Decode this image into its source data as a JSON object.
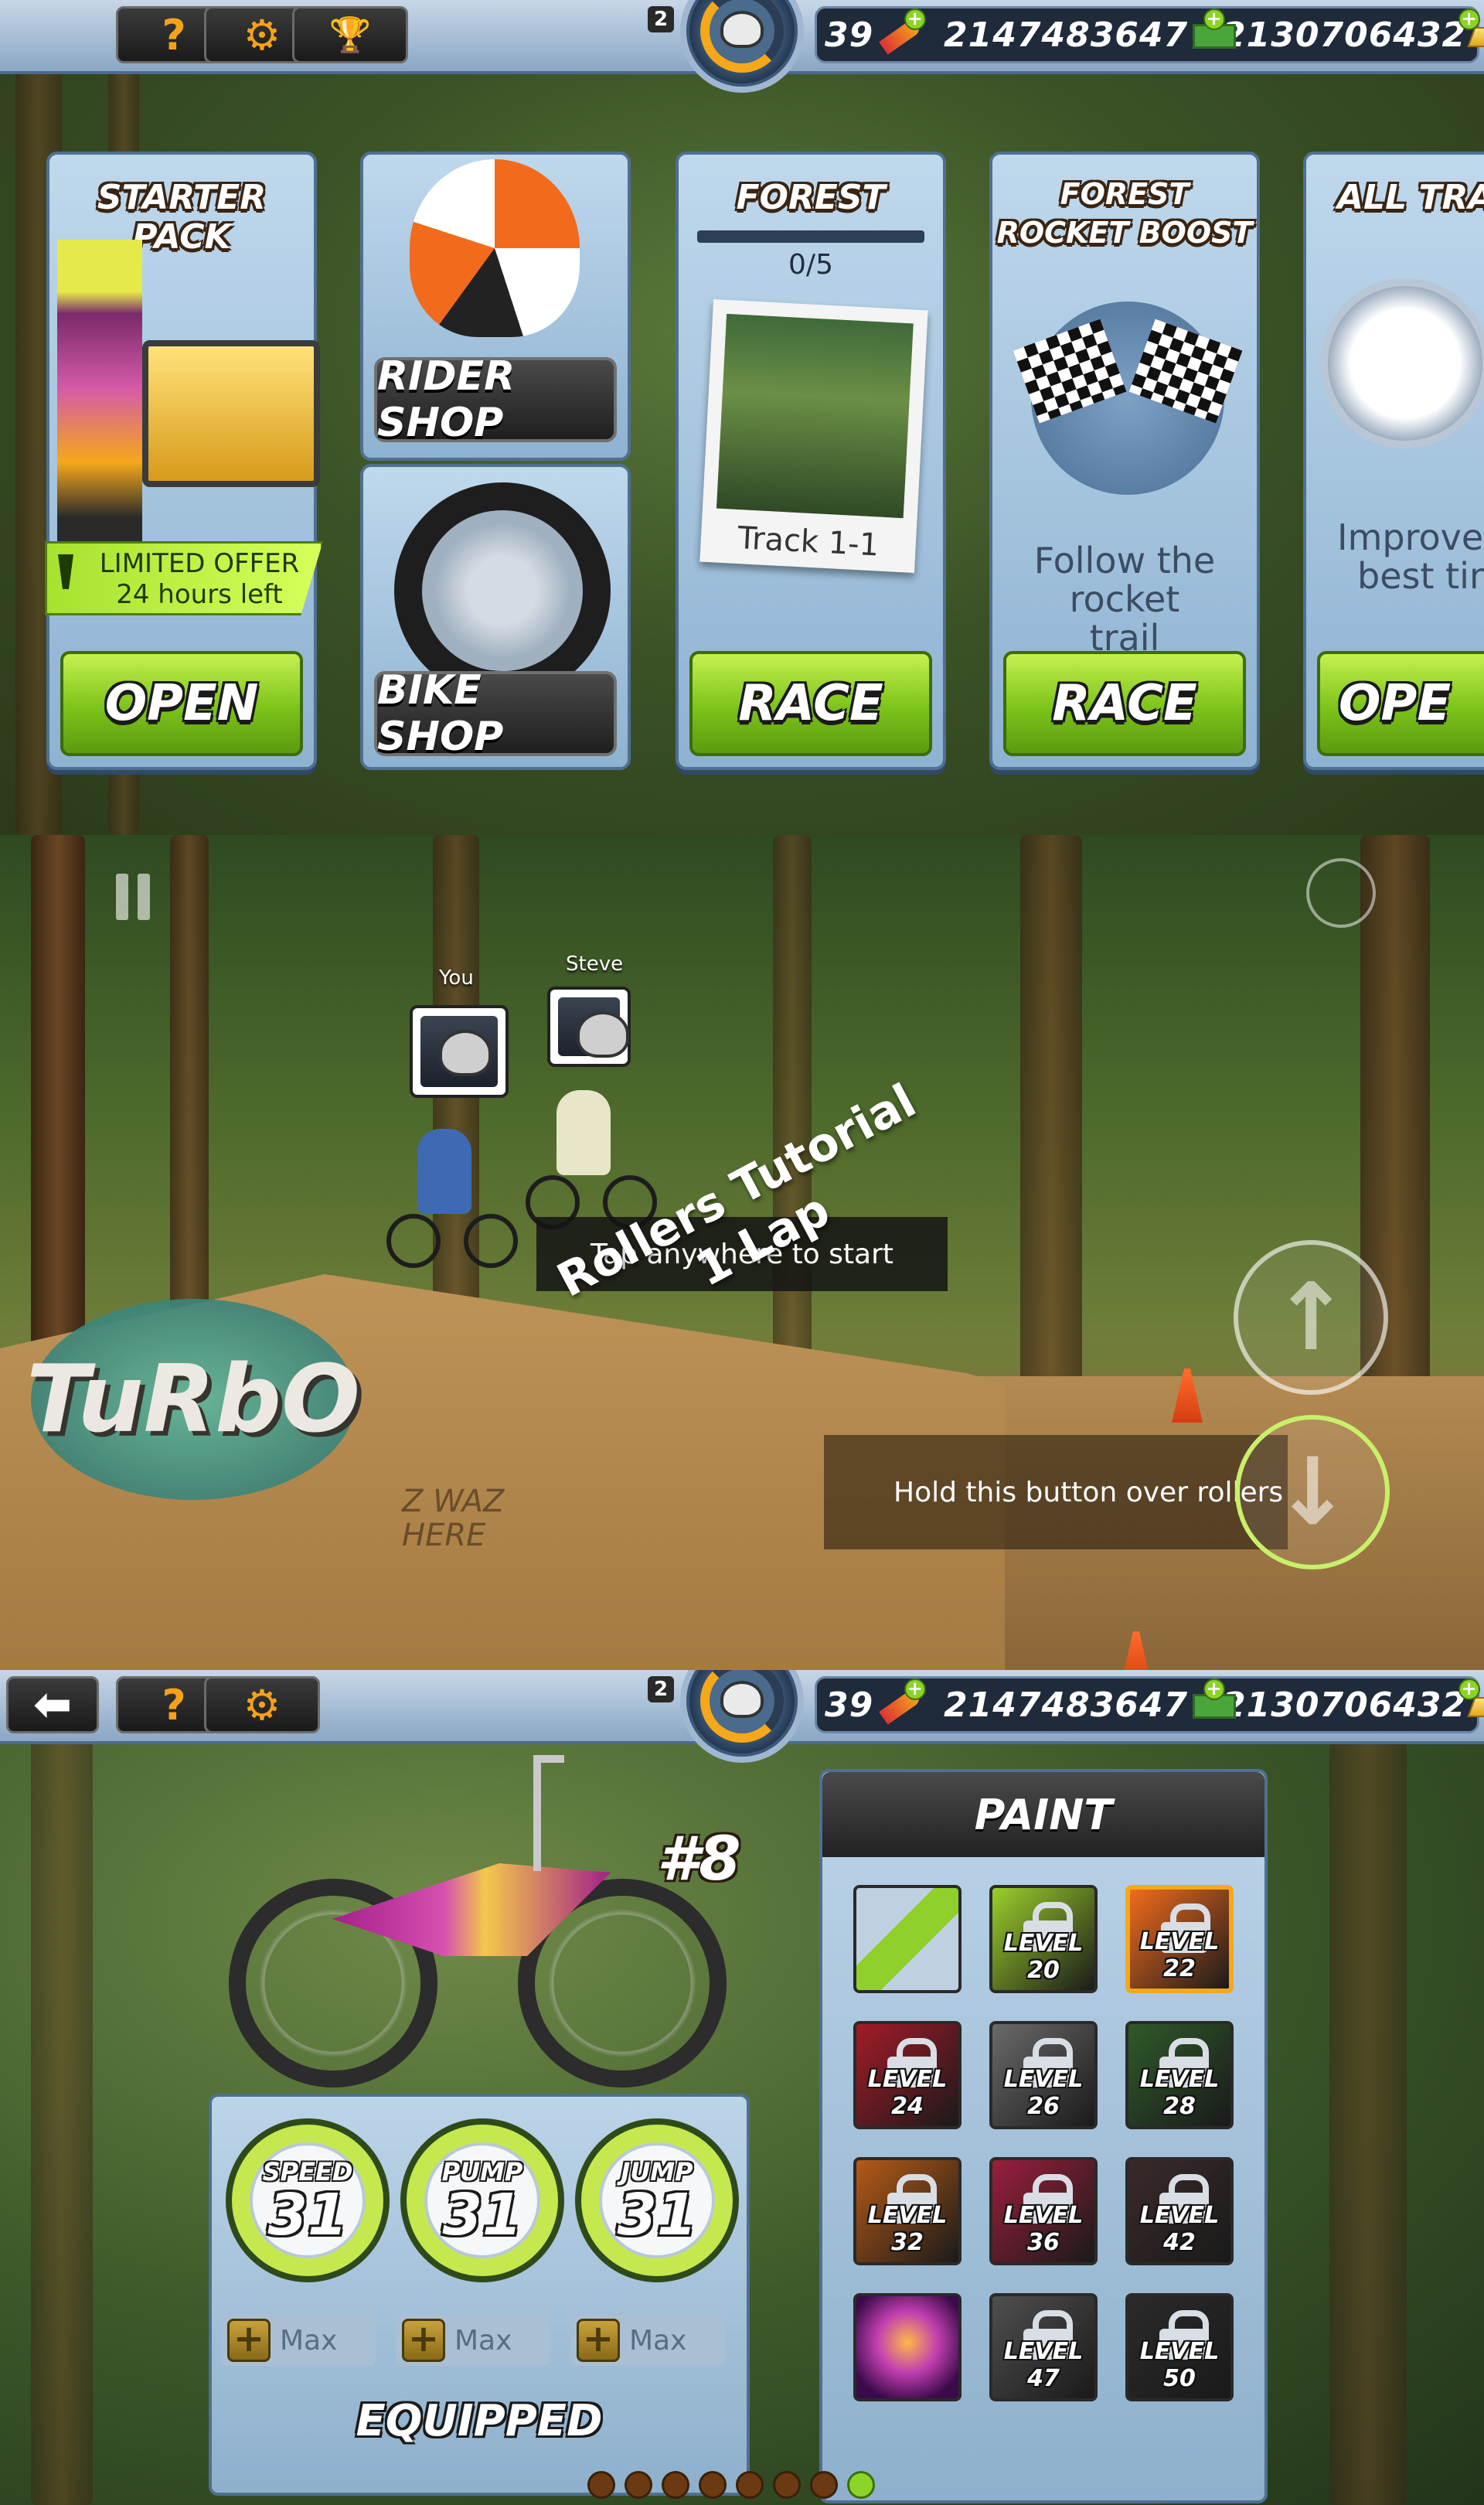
{
  "screens": [
    {
      "id": "home",
      "topbar": {
        "buttons": [
          {
            "icon": "help-icon",
            "label": "?"
          },
          {
            "icon": "gear-icon",
            "label": "⚙"
          },
          {
            "icon": "trophy-icon",
            "label": "🏆"
          }
        ],
        "player_level": "2",
        "currencies": [
          {
            "icon": "rocket-icon",
            "value": "39"
          },
          {
            "icon": "cash-icon",
            "value": "2147483647"
          },
          {
            "icon": "gold-bar-icon",
            "value": "2130706432"
          }
        ]
      },
      "cards": {
        "starter": {
          "title": "STARTER PACK",
          "offer_line1": "LIMITED OFFER",
          "offer_line2": "24 hours left",
          "button": "OPEN"
        },
        "shop": {
          "rider": "RIDER SHOP",
          "bike": "BIKE SHOP"
        },
        "forest": {
          "title": "FOREST",
          "progress": "0/5",
          "progress_value": 0,
          "photo_caption": "Track 1-1",
          "button": "RACE"
        },
        "rocket": {
          "title_line1": "FOREST",
          "title_line2": "ROCKET BOOST",
          "desc_line1": "Follow the rocket",
          "desc_line2": "trail",
          "button": "RACE"
        },
        "alltracks": {
          "title": "ALL TRAC",
          "desc_line1": "Improve y",
          "desc_line2": "best tin",
          "button": "OPE"
        }
      }
    },
    {
      "id": "race",
      "players": [
        {
          "name": "You"
        },
        {
          "name": "Steve"
        }
      ],
      "tap_prompt": "Tap anywhere to start",
      "hold_prompt": "Hold this button over rollers",
      "track_line1": "Rollers Tutorial",
      "track_line2": "1 Lap",
      "graffiti": "TuRbO",
      "graffiti2": "Z WAZ HERE"
    },
    {
      "id": "garage",
      "topbar": {
        "player_level": "2",
        "currencies": [
          {
            "icon": "rocket-icon",
            "value": "39"
          },
          {
            "icon": "cash-icon",
            "value": "2147483647"
          },
          {
            "icon": "gold-bar-icon",
            "value": "2130706432"
          }
        ]
      },
      "bike_number": "#8",
      "stats": [
        {
          "label": "SPEED",
          "value": "31",
          "upgrade": "Max"
        },
        {
          "label": "PUMP",
          "value": "31",
          "upgrade": "Max"
        },
        {
          "label": "JUMP",
          "value": "31",
          "upgrade": "Max"
        }
      ],
      "equipped": "EQUIPPED",
      "paint": {
        "title": "PAINT",
        "swatches": [
          {
            "label": "",
            "color": "#8fd12a",
            "locked": false
          },
          {
            "label": "LEVEL 20",
            "color": "#9ccf2a",
            "locked": true
          },
          {
            "label": "LEVEL 22",
            "color": "#f26b1d",
            "locked": true,
            "selected": true
          },
          {
            "label": "LEVEL 24",
            "color": "#a31b28",
            "locked": true
          },
          {
            "label": "LEVEL 26",
            "color": "#6a6a6a",
            "locked": true
          },
          {
            "label": "LEVEL 28",
            "color": "#2f5a2a",
            "locked": true
          },
          {
            "label": "LEVEL 32",
            "color": "#b55a16",
            "locked": true
          },
          {
            "label": "LEVEL 36",
            "color": "#9a1f3a",
            "locked": true
          },
          {
            "label": "LEVEL 42",
            "color": "#3a2a2a",
            "locked": true
          },
          {
            "label": "",
            "color": "#c13fb0",
            "locked": false
          },
          {
            "label": "LEVEL 47",
            "color": "#4f4f4f",
            "locked": true
          },
          {
            "label": "LEVEL 50",
            "color": "#2a2a2a",
            "locked": true
          }
        ]
      },
      "page_dots": 8,
      "active_dot": 7
    }
  ]
}
